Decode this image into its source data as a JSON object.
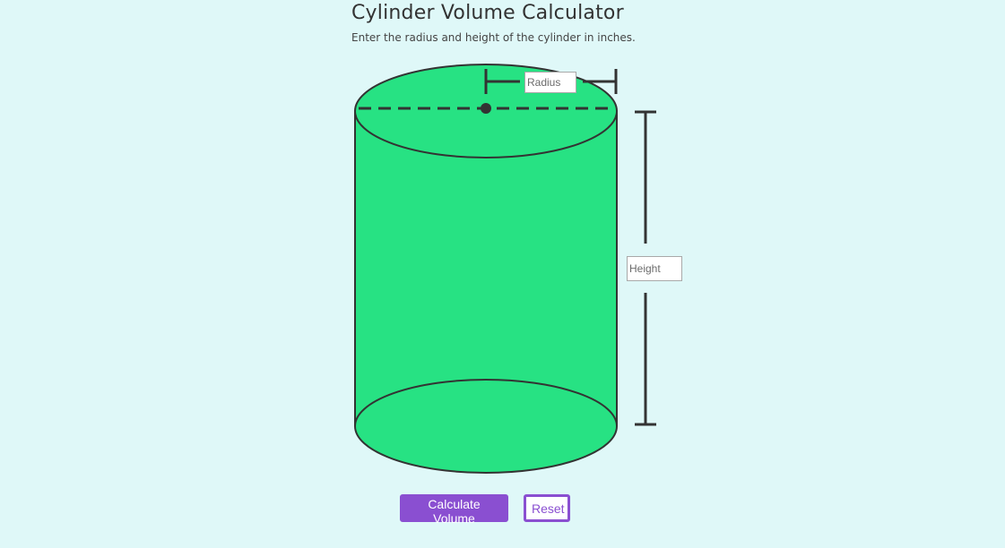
{
  "header": {
    "title": "Cylinder Volume Calculator",
    "subtitle": "Enter the radius and height of the cylinder in inches."
  },
  "inputs": {
    "radius": {
      "placeholder": "Radius",
      "value": ""
    },
    "height": {
      "placeholder": "Height",
      "value": ""
    }
  },
  "actions": {
    "calculate_label": "Calculate Volume",
    "reset_label": "Reset"
  },
  "colors": {
    "background": "#dff8f8",
    "cylinder_fill": "#27e283",
    "outline": "#333333",
    "accent": "#8a4fd1"
  }
}
